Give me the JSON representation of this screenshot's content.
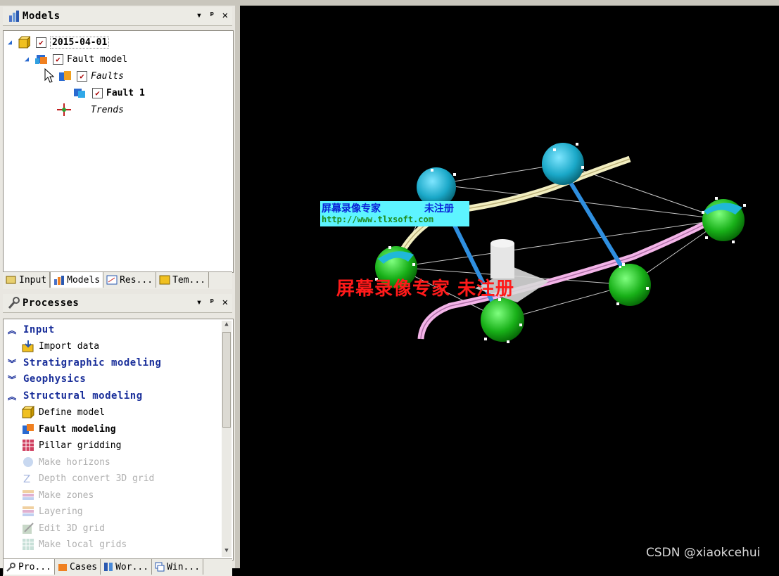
{
  "models_pane": {
    "title": "Models",
    "tree": {
      "date_node": "2015-04-01",
      "fault_model": "Fault model",
      "faults_folder": "Faults",
      "fault_1": "Fault 1",
      "trends": "Trends"
    },
    "tabs": [
      "Input",
      "Models",
      "Res...",
      "Tem..."
    ]
  },
  "processes_pane": {
    "title": "Processes",
    "categories": {
      "input": "Input",
      "stratigraphic": "Stratigraphic modeling",
      "geophysics": "Geophysics",
      "structural": "Structural modeling"
    },
    "items": {
      "import_data": "Import data",
      "define_model": "Define model",
      "fault_modeling": "Fault modeling",
      "pillar_gridding": "Pillar gridding",
      "make_horizons": "Make horizons",
      "depth_convert": "Depth convert 3D grid",
      "make_zones": "Make zones",
      "layering": "Layering",
      "edit_3d_grid": "Edit 3D grid",
      "make_local_grids": "Make local grids"
    },
    "tabs": [
      "Pro...",
      "Cases",
      "Wor...",
      "Win..."
    ]
  },
  "viewport": {
    "watermark_cn": "屏幕录像专家",
    "watermark_unreg": "未注册",
    "watermark_url": "http://www.tlxsoft.com",
    "watermark_red": "屏幕录像专家 未注册"
  },
  "credit": "CSDN @xiaokcehui",
  "colors": {
    "category_blue": "#1a2f9a",
    "pillar_blue": "#2f8fe0",
    "cube_cyan": "#1aa8c8",
    "cube_green": "#18b018",
    "trace_yellow": "#f2eec0",
    "trace_pink": "#f3b4e8"
  }
}
